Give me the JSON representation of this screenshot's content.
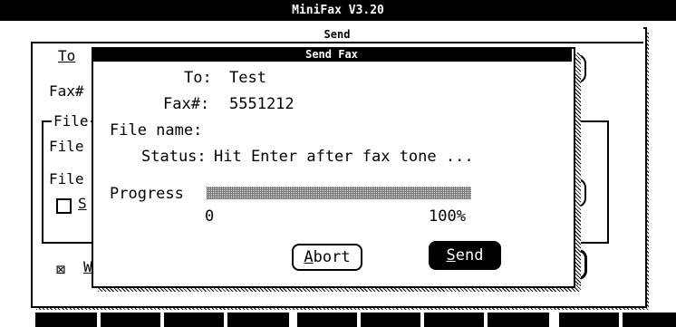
{
  "app": {
    "title": "MiniFax  V3.20"
  },
  "send_window": {
    "title": "Send",
    "frag_to": "To",
    "frag_fax": "Fax#",
    "frag_file_group": "File",
    "frag_file1": "File",
    "frag_file2": "File",
    "frag_s": "S",
    "frag_w": "W"
  },
  "dialog": {
    "title": "Send Fax",
    "to_label": "To:",
    "to_value": "Test",
    "fax_label": "Fax#:",
    "fax_value": "5551212",
    "file_label": "File name:",
    "file_value": "",
    "status_label": "Status:",
    "status_value": "Hit Enter after fax tone ...",
    "progress_label": "Progress",
    "progress_min": "0",
    "progress_max": "100%",
    "progress_value": 0,
    "abort_first": "A",
    "abort_rest": "bort",
    "send_first": "S",
    "send_rest": "end"
  }
}
